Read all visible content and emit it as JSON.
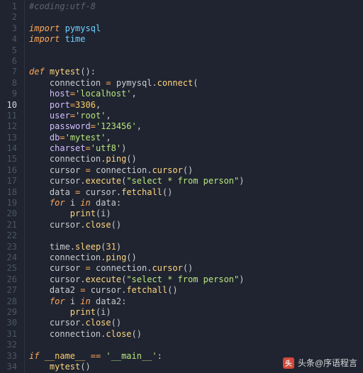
{
  "colors": {
    "bg": "#1f2430",
    "gutter_fg": "#4c5566",
    "gutter_hl": "#d4d7de"
  },
  "gutter": {
    "highlight_line_index": 9,
    "numbers": [
      "1",
      "2",
      "3",
      "4",
      "5",
      "6",
      "7",
      "8",
      "9",
      "10",
      "11",
      "12",
      "13",
      "14",
      "15",
      "16",
      "17",
      "18",
      "19",
      "20",
      "21",
      "22",
      "23",
      "24",
      "25",
      "26",
      "27",
      "28",
      "29",
      "30",
      "31",
      "32",
      "33",
      "34"
    ]
  },
  "code": {
    "lines": [
      [
        {
          "cls": "tk-comment",
          "t": "#coding:utf-8"
        }
      ],
      [],
      [
        {
          "cls": "tk-keyword",
          "t": "import"
        },
        {
          "cls": "",
          "t": " "
        },
        {
          "cls": "tk-module",
          "t": "pymysql"
        }
      ],
      [
        {
          "cls": "tk-keyword",
          "t": "import"
        },
        {
          "cls": "",
          "t": " "
        },
        {
          "cls": "tk-module",
          "t": "time"
        }
      ],
      [],
      [],
      [
        {
          "cls": "tk-keyword",
          "t": "def"
        },
        {
          "cls": "",
          "t": " "
        },
        {
          "cls": "tk-func",
          "t": "mytest"
        },
        {
          "cls": "tk-punc",
          "t": "():"
        }
      ],
      [
        {
          "cls": "",
          "t": "    "
        },
        {
          "cls": "tk-var",
          "t": "connection"
        },
        {
          "cls": "",
          "t": " "
        },
        {
          "cls": "tk-op",
          "t": "="
        },
        {
          "cls": "",
          "t": " "
        },
        {
          "cls": "tk-var",
          "t": "pymysql"
        },
        {
          "cls": "tk-punc",
          "t": "."
        },
        {
          "cls": "tk-func",
          "t": "connect"
        },
        {
          "cls": "tk-punc",
          "t": "("
        }
      ],
      [
        {
          "cls": "",
          "t": "    "
        },
        {
          "cls": "tk-param",
          "t": "host"
        },
        {
          "cls": "tk-op",
          "t": "="
        },
        {
          "cls": "tk-string",
          "t": "'localhost'"
        },
        {
          "cls": "tk-punc",
          "t": ","
        }
      ],
      [
        {
          "cls": "",
          "t": "    "
        },
        {
          "cls": "tk-param",
          "t": "port"
        },
        {
          "cls": "tk-op",
          "t": "="
        },
        {
          "cls": "tk-num",
          "t": "3306"
        },
        {
          "cls": "tk-punc",
          "t": ","
        }
      ],
      [
        {
          "cls": "",
          "t": "    "
        },
        {
          "cls": "tk-param",
          "t": "user"
        },
        {
          "cls": "tk-op",
          "t": "="
        },
        {
          "cls": "tk-string",
          "t": "'root'"
        },
        {
          "cls": "tk-punc",
          "t": ","
        }
      ],
      [
        {
          "cls": "",
          "t": "    "
        },
        {
          "cls": "tk-param",
          "t": "password"
        },
        {
          "cls": "tk-op",
          "t": "="
        },
        {
          "cls": "tk-string",
          "t": "'123456'"
        },
        {
          "cls": "tk-punc",
          "t": ","
        }
      ],
      [
        {
          "cls": "",
          "t": "    "
        },
        {
          "cls": "tk-param",
          "t": "db"
        },
        {
          "cls": "tk-op",
          "t": "="
        },
        {
          "cls": "tk-string",
          "t": "'mytest'"
        },
        {
          "cls": "tk-punc",
          "t": ","
        }
      ],
      [
        {
          "cls": "",
          "t": "    "
        },
        {
          "cls": "tk-param",
          "t": "charset"
        },
        {
          "cls": "tk-op",
          "t": "="
        },
        {
          "cls": "tk-string",
          "t": "'utf8'"
        },
        {
          "cls": "tk-punc",
          "t": ")"
        }
      ],
      [
        {
          "cls": "",
          "t": "    "
        },
        {
          "cls": "tk-var",
          "t": "connection"
        },
        {
          "cls": "tk-punc",
          "t": "."
        },
        {
          "cls": "tk-func",
          "t": "ping"
        },
        {
          "cls": "tk-punc",
          "t": "()"
        }
      ],
      [
        {
          "cls": "",
          "t": "    "
        },
        {
          "cls": "tk-var",
          "t": "cursor"
        },
        {
          "cls": "",
          "t": " "
        },
        {
          "cls": "tk-op",
          "t": "="
        },
        {
          "cls": "",
          "t": " "
        },
        {
          "cls": "tk-var",
          "t": "connection"
        },
        {
          "cls": "tk-punc",
          "t": "."
        },
        {
          "cls": "tk-func",
          "t": "cursor"
        },
        {
          "cls": "tk-punc",
          "t": "()"
        }
      ],
      [
        {
          "cls": "",
          "t": "    "
        },
        {
          "cls": "tk-var",
          "t": "cursor"
        },
        {
          "cls": "tk-punc",
          "t": "."
        },
        {
          "cls": "tk-func",
          "t": "execute"
        },
        {
          "cls": "tk-punc",
          "t": "("
        },
        {
          "cls": "tk-string",
          "t": "\"select * from person\""
        },
        {
          "cls": "tk-punc",
          "t": ")"
        }
      ],
      [
        {
          "cls": "",
          "t": "    "
        },
        {
          "cls": "tk-var",
          "t": "data"
        },
        {
          "cls": "",
          "t": " "
        },
        {
          "cls": "tk-op",
          "t": "="
        },
        {
          "cls": "",
          "t": " "
        },
        {
          "cls": "tk-var",
          "t": "cursor"
        },
        {
          "cls": "tk-punc",
          "t": "."
        },
        {
          "cls": "tk-func",
          "t": "fetchall"
        },
        {
          "cls": "tk-punc",
          "t": "()"
        }
      ],
      [
        {
          "cls": "",
          "t": "    "
        },
        {
          "cls": "tk-keyword",
          "t": "for"
        },
        {
          "cls": "",
          "t": " "
        },
        {
          "cls": "tk-var",
          "t": "i"
        },
        {
          "cls": "",
          "t": " "
        },
        {
          "cls": "tk-keyword",
          "t": "in"
        },
        {
          "cls": "",
          "t": " "
        },
        {
          "cls": "tk-var",
          "t": "data"
        },
        {
          "cls": "tk-punc",
          "t": ":"
        }
      ],
      [
        {
          "cls": "",
          "t": "        "
        },
        {
          "cls": "tk-func",
          "t": "print"
        },
        {
          "cls": "tk-punc",
          "t": "("
        },
        {
          "cls": "tk-var",
          "t": "i"
        },
        {
          "cls": "tk-punc",
          "t": ")"
        }
      ],
      [
        {
          "cls": "",
          "t": "    "
        },
        {
          "cls": "tk-var",
          "t": "cursor"
        },
        {
          "cls": "tk-punc",
          "t": "."
        },
        {
          "cls": "tk-func",
          "t": "close"
        },
        {
          "cls": "tk-punc",
          "t": "()"
        }
      ],
      [],
      [
        {
          "cls": "",
          "t": "    "
        },
        {
          "cls": "tk-var",
          "t": "time"
        },
        {
          "cls": "tk-punc",
          "t": "."
        },
        {
          "cls": "tk-func",
          "t": "sleep"
        },
        {
          "cls": "tk-punc",
          "t": "("
        },
        {
          "cls": "tk-num",
          "t": "31"
        },
        {
          "cls": "tk-punc",
          "t": ")"
        }
      ],
      [
        {
          "cls": "",
          "t": "    "
        },
        {
          "cls": "tk-var",
          "t": "connection"
        },
        {
          "cls": "tk-punc",
          "t": "."
        },
        {
          "cls": "tk-func",
          "t": "ping"
        },
        {
          "cls": "tk-punc",
          "t": "()"
        }
      ],
      [
        {
          "cls": "",
          "t": "    "
        },
        {
          "cls": "tk-var",
          "t": "cursor"
        },
        {
          "cls": "",
          "t": " "
        },
        {
          "cls": "tk-op",
          "t": "="
        },
        {
          "cls": "",
          "t": " "
        },
        {
          "cls": "tk-var",
          "t": "connection"
        },
        {
          "cls": "tk-punc",
          "t": "."
        },
        {
          "cls": "tk-func",
          "t": "cursor"
        },
        {
          "cls": "tk-punc",
          "t": "()"
        }
      ],
      [
        {
          "cls": "",
          "t": "    "
        },
        {
          "cls": "tk-var",
          "t": "cursor"
        },
        {
          "cls": "tk-punc",
          "t": "."
        },
        {
          "cls": "tk-func",
          "t": "execute"
        },
        {
          "cls": "tk-punc",
          "t": "("
        },
        {
          "cls": "tk-string",
          "t": "\"select * from person\""
        },
        {
          "cls": "tk-punc",
          "t": ")"
        }
      ],
      [
        {
          "cls": "",
          "t": "    "
        },
        {
          "cls": "tk-var",
          "t": "data2"
        },
        {
          "cls": "",
          "t": " "
        },
        {
          "cls": "tk-op",
          "t": "="
        },
        {
          "cls": "",
          "t": " "
        },
        {
          "cls": "tk-var",
          "t": "cursor"
        },
        {
          "cls": "tk-punc",
          "t": "."
        },
        {
          "cls": "tk-func",
          "t": "fetchall"
        },
        {
          "cls": "tk-punc",
          "t": "()"
        }
      ],
      [
        {
          "cls": "",
          "t": "    "
        },
        {
          "cls": "tk-keyword",
          "t": "for"
        },
        {
          "cls": "",
          "t": " "
        },
        {
          "cls": "tk-var",
          "t": "i"
        },
        {
          "cls": "",
          "t": " "
        },
        {
          "cls": "tk-keyword",
          "t": "in"
        },
        {
          "cls": "",
          "t": " "
        },
        {
          "cls": "tk-var",
          "t": "data2"
        },
        {
          "cls": "tk-punc",
          "t": ":"
        }
      ],
      [
        {
          "cls": "",
          "t": "        "
        },
        {
          "cls": "tk-func",
          "t": "print"
        },
        {
          "cls": "tk-punc",
          "t": "("
        },
        {
          "cls": "tk-var",
          "t": "i"
        },
        {
          "cls": "tk-punc",
          "t": ")"
        }
      ],
      [
        {
          "cls": "",
          "t": "    "
        },
        {
          "cls": "tk-var",
          "t": "cursor"
        },
        {
          "cls": "tk-punc",
          "t": "."
        },
        {
          "cls": "tk-func",
          "t": "close"
        },
        {
          "cls": "tk-punc",
          "t": "()"
        }
      ],
      [
        {
          "cls": "",
          "t": "    "
        },
        {
          "cls": "tk-var",
          "t": "connection"
        },
        {
          "cls": "tk-punc",
          "t": "."
        },
        {
          "cls": "tk-func",
          "t": "close"
        },
        {
          "cls": "tk-punc",
          "t": "()"
        }
      ],
      [],
      [
        {
          "cls": "tk-keyword",
          "t": "if"
        },
        {
          "cls": "",
          "t": " "
        },
        {
          "cls": "tk-const",
          "t": "__name__"
        },
        {
          "cls": "",
          "t": " "
        },
        {
          "cls": "tk-op",
          "t": "=="
        },
        {
          "cls": "",
          "t": " "
        },
        {
          "cls": "tk-string",
          "t": "'__main__'"
        },
        {
          "cls": "tk-punc",
          "t": ":"
        }
      ],
      [
        {
          "cls": "",
          "t": "    "
        },
        {
          "cls": "tk-func",
          "t": "mytest"
        },
        {
          "cls": "tk-punc",
          "t": "()"
        }
      ]
    ]
  },
  "watermark": {
    "logo_text": "头",
    "text": "头条@序语程言"
  }
}
